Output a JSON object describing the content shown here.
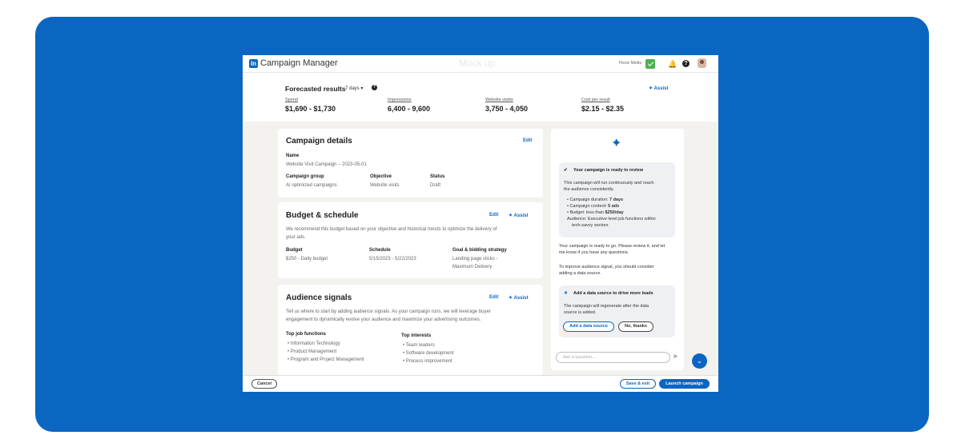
{
  "header": {
    "logo_text": "in",
    "app_title": "Campaign Manager",
    "watermark": "Mock up",
    "account_name": "Flexis Media"
  },
  "forecast": {
    "title": "Forecasted results",
    "range": "7 days ▾",
    "help": "?",
    "assist": "✦ Assist",
    "metrics": [
      {
        "label": "Spend",
        "value": "$1,690 - $1,730"
      },
      {
        "label": "Impressions",
        "value": "6,400 - 9,600"
      },
      {
        "label": "Website visitis",
        "value": "3,750 - 4,050"
      },
      {
        "label": "Cost per result",
        "value": "$2.15 - $2.35"
      }
    ]
  },
  "campaign_details": {
    "title": "Campaign details",
    "edit": "Edit",
    "name_label": "Name",
    "name_value": "Website Visit Campaign – 2023-05-01",
    "group_label": "Campaign group",
    "group_value": "AI optimized campaigns",
    "objective_label": "Objective",
    "objective_value": "Website visits",
    "status_label": "Status",
    "status_value": "Draft"
  },
  "budget": {
    "title": "Budget & schedule",
    "edit": "Edit",
    "assist": "✦ Assist",
    "desc1": "We recommend this budget based on your objective and historical trends to optimize the delivery of",
    "desc2": "your ads.",
    "budget_label": "Budget",
    "budget_value": "$250 - Daily budget",
    "schedule_label": "Schedule",
    "schedule_value": "5/15/2023 - 5/22/2023",
    "goal_label": "Goal & bidding strategy",
    "goal_value1": "Landing page clicks -",
    "goal_value2": "Maximum Delivery"
  },
  "audience": {
    "title": "Audience signals",
    "edit": "Edit",
    "assist": "✦ Assist",
    "desc1": "Tell us where to start by adding audience signals. As your campaign runs, we will leverage buyer",
    "desc2": "engagement to dynamically evolve your audience and maximize your advertising outcomes.",
    "job_title": "Top job functions",
    "jobs": [
      "Information Technology",
      "Product Management",
      "Program and Project Management"
    ],
    "interests_title": "Top interests",
    "interests": [
      "Team leaders",
      "Software development",
      "Process improvement"
    ]
  },
  "assistant": {
    "sparkle": "✦",
    "ready_title": "Your campaign is ready to review",
    "ready_body1": "This campaign will run continuously and reach",
    "ready_body2": "the audience consistently.",
    "bullets": [
      "Campaign duration: 7 days",
      "Campaign content: 5 ads",
      "Budget: less than $250/day",
      "Audience: Executive level job functions within",
      "tech-savvy sectors"
    ],
    "msg1a": "Your campaign is ready to go. Please review it, and let",
    "msg1b": "me know if you have any questions.",
    "msg2a": "To improve audience signal, you should consider",
    "msg2b": "adding a data source.",
    "suggest_title": "Add a data source to drive more leads",
    "suggest_body1": "The campaign will regenerate after the data",
    "suggest_body2": "source is added.",
    "add_btn": "Add a data source",
    "no_btn": "No, thanks",
    "ask_placeholder": "Ask a question...",
    "send": "➤",
    "fab": "⌄"
  },
  "footer": {
    "cancel": "Cancel",
    "save": "Save & exit",
    "launch": "Launch campaign"
  },
  "colors": {
    "brand": "#0a66c2",
    "stage": "#0b66c2"
  }
}
